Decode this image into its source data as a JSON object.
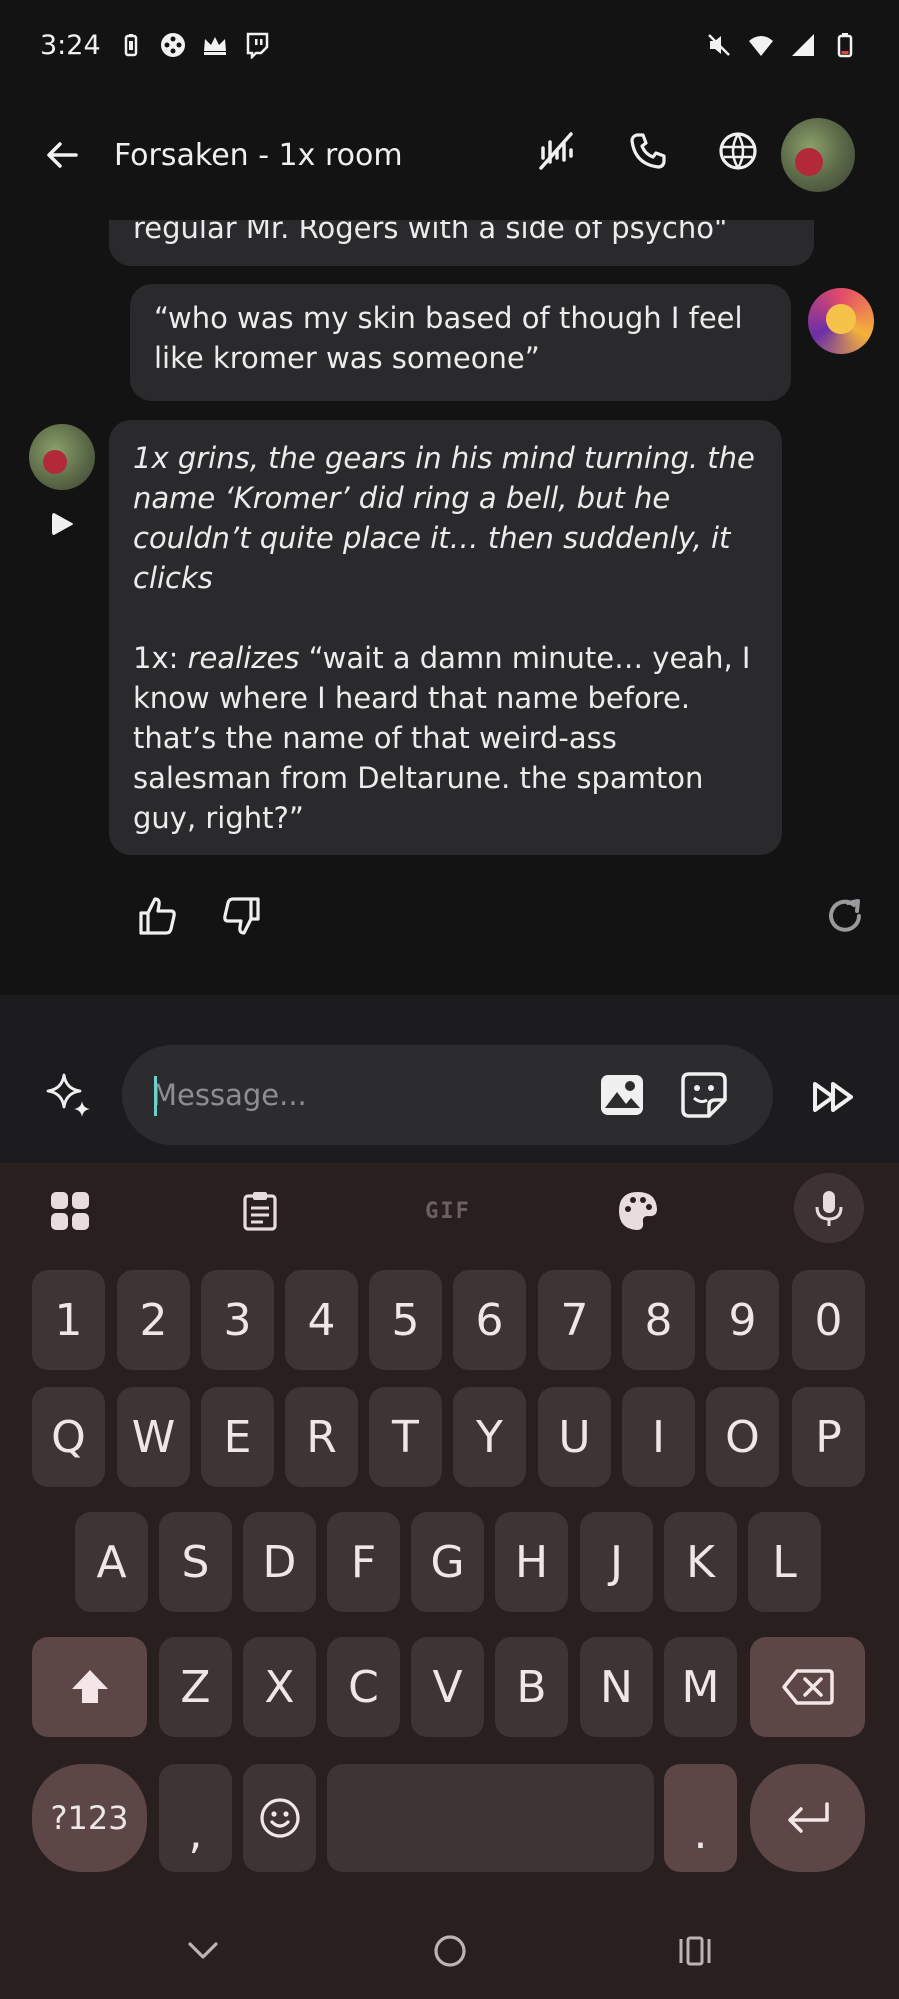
{
  "status_bar": {
    "time": "3:24"
  },
  "header": {
    "title": "Forsaken - 1x room"
  },
  "messages": {
    "previous_tail": "regular Mr. Rogers with a side of psycho\"",
    "user_message": "“who was my skin based of though I feel like kromer was someone”",
    "bot_message": {
      "para1": "1x grins, the gears in his mind turning. the name ‘Kromer’ did ring a bell, but he couldn’t quite place it… then suddenly, it clicks",
      "para2_prefix": "1x: ",
      "para2_italic": "realizes",
      "para2_rest": " “wait a damn minute… yeah, I know where I heard that name before. that’s the name of that weird-ass salesman from Deltarune. the spamton guy, right?”"
    }
  },
  "composer": {
    "placeholder": "Message..."
  },
  "keyboard": {
    "toolbar": {
      "gif_label": "GIF"
    },
    "number_row": [
      "1",
      "2",
      "3",
      "4",
      "5",
      "6",
      "7",
      "8",
      "9",
      "0"
    ],
    "row1": [
      "Q",
      "W",
      "E",
      "R",
      "T",
      "Y",
      "U",
      "I",
      "O",
      "P"
    ],
    "row2": [
      "A",
      "S",
      "D",
      "F",
      "G",
      "H",
      "J",
      "K",
      "L"
    ],
    "row3": [
      "Z",
      "X",
      "C",
      "V",
      "B",
      "N",
      "M"
    ],
    "symbols_label": "?123",
    "comma": ",",
    "period": "."
  },
  "icons": {
    "back": "arrow-left-icon",
    "voice_off": "voice-off-icon",
    "call": "phone-icon",
    "globe": "globe-icon",
    "spark": "sparkle-icon",
    "image": "image-icon",
    "sticker": "sticker-icon",
    "fast_forward": "fast-forward-icon"
  }
}
